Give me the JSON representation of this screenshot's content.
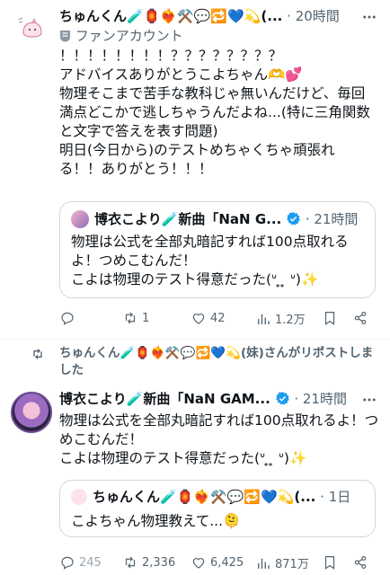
{
  "post1": {
    "name": "ちゅんくん🧪🏮❤️‍🔥⚒️💬🔁💙💫(...",
    "time": "· 20時間",
    "fan_label": "ファンアカウント",
    "body": "！！！！！！！！？？？？？？？？\nアドバイスありがとうこよちゃん🫶💕\n物理そこまで苦手な教科じゃ無いんだけど、毎回満点どこかで逃しちゃうんだよね...(特に三角関数と文字で答えを表す問題)\n明日(今日から)のテストめちゃくちゃ頑張れる！！ありがとう！！！",
    "quote": {
      "name": "博衣こより🧪新曲「NaN G...",
      "time": "· 21時間",
      "body": "物理は公式を全部丸暗記すれば100点取れるよ！つめこむんだ！\nこよは物理のテスト得意だった(ᐡ ̥ ̥ ᐡ)✨"
    },
    "actions": {
      "reply": "",
      "retweet": "1",
      "like": "42",
      "views": "1.2万"
    }
  },
  "repost_banner": "ちゅんくん🧪🏮❤️‍🔥⚒️💬🔁💙💫(妹)さんがリポストしました",
  "post2": {
    "name": "博衣こより🧪新曲「NaN GAM...",
    "time": "· 21時間",
    "body": "物理は公式を全部丸暗記すれば100点取れるよ！つめこむんだ！\nこよは物理のテスト得意だった(ᐡ ̥ ̥ ᐡ)✨",
    "quote": {
      "name": "ちゅんくん🧪🏮❤️‍🔥⚒️💬🔁💙💫(...",
      "time": "· 1日",
      "body": "こよちゃん物理教えて...🫠"
    },
    "actions": {
      "reply": "245",
      "retweet": "2,336",
      "like": "6,425",
      "views": "871万"
    }
  },
  "colors": {
    "verified": "#1d9bf0",
    "text": "#0f1419",
    "muted": "#536471",
    "border": "#cfd9de"
  }
}
